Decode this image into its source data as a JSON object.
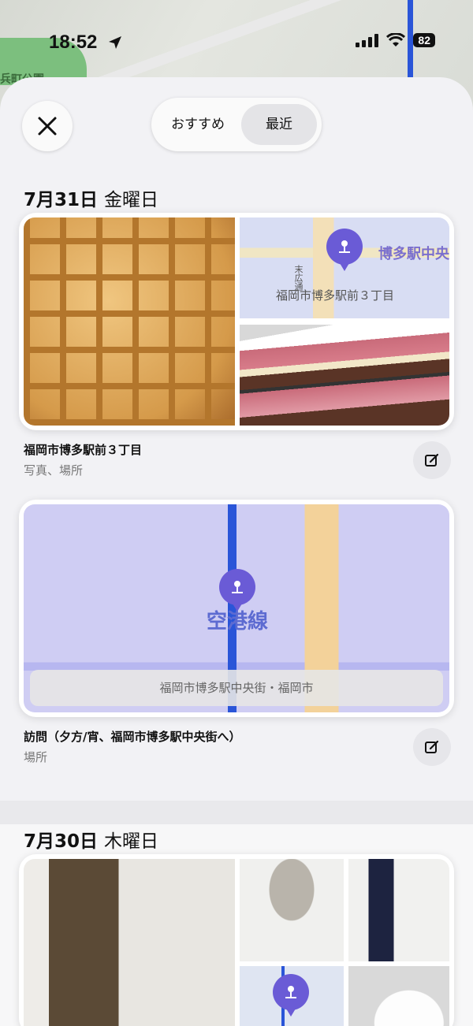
{
  "status": {
    "time": "18:52",
    "battery": "82"
  },
  "map_bg": {
    "park_label": "兵町公園"
  },
  "header": {
    "close_label": "×",
    "segments": [
      "おすすめ",
      "最近"
    ],
    "selected_segment": "最近"
  },
  "days": [
    {
      "date": "7月31日",
      "weekday": "金曜日",
      "cards": [
        {
          "map_label_large": "博多駅中央",
          "map_label": "福岡市博多駅前３丁目",
          "map_street": "末広通",
          "title": "福岡市博多駅前３丁目",
          "subtitle": "写真、場所"
        },
        {
          "map_label_large": "空港線",
          "map_banner": "福岡市博多駅中央街・福岡市",
          "title": "訪問（夕方/宵、福岡市博多駅中央街へ）",
          "subtitle": "場所"
        }
      ]
    },
    {
      "date": "7月30日",
      "weekday": "木曜日"
    }
  ],
  "colors": {
    "pin": "#6a5bd6",
    "accent_blue": "#2a55d8"
  },
  "icons": [
    "location-arrow-icon",
    "signal-icon",
    "wifi-icon",
    "battery-icon",
    "close-icon",
    "edit-icon",
    "map-pin-icon"
  ]
}
